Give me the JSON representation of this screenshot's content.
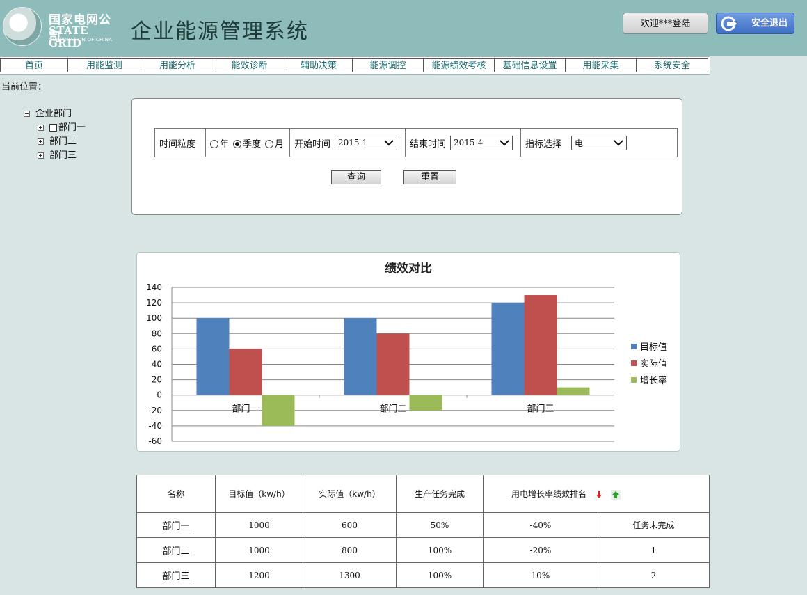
{
  "header": {
    "logo_cn": "国家电网公司",
    "logo_en": "STATE GRID",
    "logo_sub": "CORPORATION OF CHINA",
    "title": "企业能源管理系统",
    "welcome": "欢迎***登陆",
    "logout": "安全退出"
  },
  "nav": {
    "items": [
      {
        "label": "首页"
      },
      {
        "label": "用能监测"
      },
      {
        "label": "用能分析"
      },
      {
        "label": "能效诊断"
      },
      {
        "label": "辅助决策"
      },
      {
        "label": "能源调控"
      },
      {
        "label": "能源绩效考核"
      },
      {
        "label": "基础信息设置"
      },
      {
        "label": "用能采集"
      },
      {
        "label": "系统安全"
      }
    ]
  },
  "location": "当前位置：",
  "tree": {
    "root": "企业部门",
    "children": [
      "部门一",
      "部门二",
      "部门三"
    ]
  },
  "filter": {
    "granularity_label": "时间粒度",
    "options": [
      "年",
      "季度",
      "月"
    ],
    "selected": "季度",
    "start_label": "开始时间",
    "start_value": "2015-1",
    "end_label": "结束时间",
    "end_value": "2015-4",
    "indicator_label": "指标选择",
    "indicator_value": "电",
    "query": "查询",
    "reset": "重置"
  },
  "chart_data": {
    "type": "bar",
    "title": "绩效对比",
    "categories": [
      "部门一",
      "部门二",
      "部门三"
    ],
    "series": [
      {
        "name": "目标值",
        "color": "#4f81bd",
        "values": [
          100,
          100,
          120
        ]
      },
      {
        "name": "实际值",
        "color": "#c0504d",
        "values": [
          60,
          80,
          130
        ]
      },
      {
        "name": "增长率",
        "color": "#9bbb59",
        "values": [
          -40,
          -20,
          10
        ]
      }
    ],
    "ylim": [
      -60,
      140
    ],
    "yticks": [
      140,
      120,
      100,
      80,
      60,
      40,
      20,
      0,
      -20,
      -40,
      -60
    ],
    "grid": true,
    "legend": "right"
  },
  "table": {
    "headers": [
      "名称",
      "目标值（kw/h）",
      "实际值（kw/h）",
      "生产任务完成",
      "用电增长率",
      "绩效排名"
    ],
    "rows": [
      [
        "部门一",
        "1000",
        "600",
        "50%",
        "-40%",
        "任务未完成"
      ],
      [
        "部门二",
        "1000",
        "800",
        "100%",
        "-20%",
        "1"
      ],
      [
        "部门三",
        "1200",
        "1300",
        "100%",
        "10%",
        "2"
      ]
    ]
  }
}
